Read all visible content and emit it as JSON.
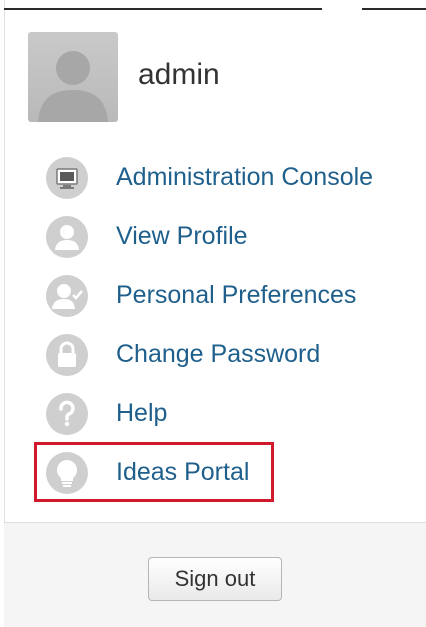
{
  "user": {
    "username": "admin",
    "avatar_icon": "default-user-avatar"
  },
  "menu": {
    "items": [
      {
        "label": "Administration Console",
        "icon": "monitor-icon"
      },
      {
        "label": "View Profile",
        "icon": "user-icon"
      },
      {
        "label": "Personal Preferences",
        "icon": "user-check-icon"
      },
      {
        "label": "Change Password",
        "icon": "lock-icon"
      },
      {
        "label": "Help",
        "icon": "question-icon"
      },
      {
        "label": "Ideas Portal",
        "icon": "lightbulb-icon",
        "highlighted": true
      }
    ]
  },
  "footer": {
    "signout_label": "Sign out"
  },
  "colors": {
    "link": "#1f5f8c",
    "highlight": "#d01a2b",
    "icon_bg": "#cfcfcf"
  }
}
